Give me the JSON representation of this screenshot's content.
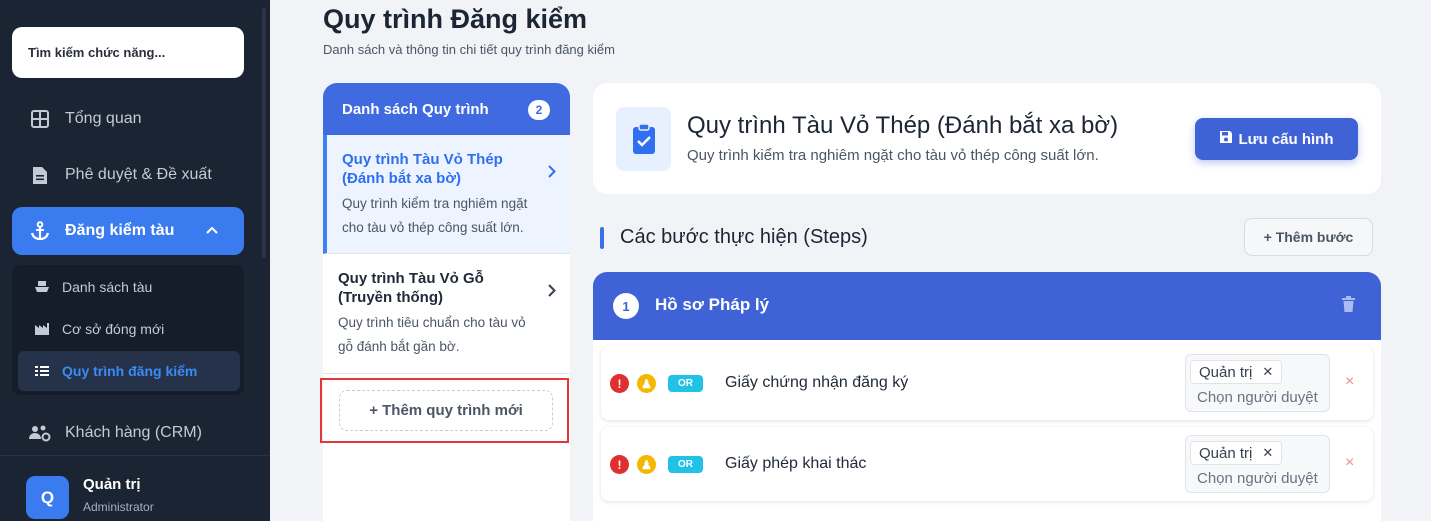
{
  "sidebar": {
    "search_placeholder": "Tìm kiếm chức năng...",
    "items": [
      {
        "label": "Tổng quan",
        "icon": "dashboard-icon"
      },
      {
        "label": "Phê duyệt & Đề xuất",
        "icon": "document-icon"
      },
      {
        "label": "Đăng kiểm tàu",
        "icon": "anchor-icon",
        "active": true
      },
      {
        "label": "Khách hàng (CRM)",
        "icon": "users-gear-icon"
      }
    ],
    "sub_items": [
      {
        "label": "Danh sách tàu",
        "icon": "ship-icon"
      },
      {
        "label": "Cơ sở đóng mới",
        "icon": "factory-icon"
      },
      {
        "label": "Quy trình đăng kiểm",
        "icon": "list-check-icon",
        "active": true
      }
    ],
    "user": {
      "initial": "Q",
      "name": "Quản trị",
      "role": "Administrator"
    }
  },
  "header": {
    "title": "Quy trình Đăng kiểm",
    "subtitle": "Danh sách và thông tin chi tiết quy trình đăng kiểm"
  },
  "process_list": {
    "title": "Danh sách Quy trình",
    "count": "2",
    "items": [
      {
        "title": "Quy trình Tàu Vỏ Thép (Đánh bắt xa bờ)",
        "desc": "Quy trình kiểm tra nghiêm ngặt cho tàu vỏ thép công suất lớn."
      },
      {
        "title": "Quy trình Tàu Vỏ Gỗ (Truyền thống)",
        "desc": "Quy trình tiêu chuẩn cho tàu vỏ gỗ đánh bắt gần bờ."
      }
    ],
    "add_label": "+ Thêm quy trình mới"
  },
  "detail": {
    "title": "Quy trình Tàu Vỏ Thép (Đánh bắt xa bờ)",
    "desc": "Quy trình kiểm tra nghiêm ngặt cho tàu vỏ thép công suất lớn.",
    "save_label": "Lưu cấu hình"
  },
  "steps": {
    "title": "Các bước thực hiện (Steps)",
    "add_label": "+ Thêm bước",
    "step1": {
      "number": "1",
      "name": "Hồ sơ Pháp lý",
      "docs": [
        {
          "name": "Giấy chứng nhận đăng ký",
          "mark1": "!",
          "mark2": "♟",
          "badge": "OR",
          "assignee": "Quản trị",
          "assign_placeholder": "Chọn người duyệt",
          "remove": "×"
        },
        {
          "name": "Giấy phép khai thác",
          "mark1": "!",
          "mark2": "♟",
          "badge": "OR",
          "assignee": "Quản trị",
          "assign_placeholder": "Chọn người duyệt",
          "remove": "×"
        }
      ]
    }
  },
  "colors": {
    "sidebar_bg": "#1b2433",
    "accent": "#3f63d6",
    "active_nav": "#3a7cf0",
    "danger": "#e02f2f",
    "highlight": "#e33636"
  }
}
